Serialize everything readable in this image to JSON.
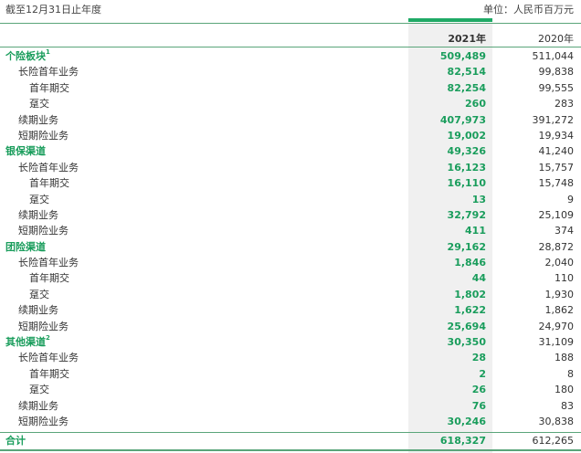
{
  "caption": {
    "period": "截至12月31日止年度",
    "unit": "单位：人民币百万元"
  },
  "header": {
    "col_2021": "2021年",
    "col_2020": "2020年"
  },
  "rows": [
    {
      "label": "个险板块",
      "sup": "1",
      "level": 0,
      "v2021": "509,489",
      "v2020": "511,044"
    },
    {
      "label": "长险首年业务",
      "level": 1,
      "v2021": "82,514",
      "v2020": "99,838"
    },
    {
      "label": "首年期交",
      "level": 2,
      "v2021": "82,254",
      "v2020": "99,555"
    },
    {
      "label": "趸交",
      "level": 2,
      "v2021": "260",
      "v2020": "283"
    },
    {
      "label": "续期业务",
      "level": 1,
      "v2021": "407,973",
      "v2020": "391,272"
    },
    {
      "label": "短期险业务",
      "level": 1,
      "v2021": "19,002",
      "v2020": "19,934"
    },
    {
      "label": "银保渠道",
      "level": 0,
      "v2021": "49,326",
      "v2020": "41,240"
    },
    {
      "label": "长险首年业务",
      "level": 1,
      "v2021": "16,123",
      "v2020": "15,757"
    },
    {
      "label": "首年期交",
      "level": 2,
      "v2021": "16,110",
      "v2020": "15,748"
    },
    {
      "label": "趸交",
      "level": 2,
      "v2021": "13",
      "v2020": "9"
    },
    {
      "label": "续期业务",
      "level": 1,
      "v2021": "32,792",
      "v2020": "25,109"
    },
    {
      "label": "短期险业务",
      "level": 1,
      "v2021": "411",
      "v2020": "374"
    },
    {
      "label": "团险渠道",
      "level": 0,
      "v2021": "29,162",
      "v2020": "28,872"
    },
    {
      "label": "长险首年业务",
      "level": 1,
      "v2021": "1,846",
      "v2020": "2,040"
    },
    {
      "label": "首年期交",
      "level": 2,
      "v2021": "44",
      "v2020": "110"
    },
    {
      "label": "趸交",
      "level": 2,
      "v2021": "1,802",
      "v2020": "1,930"
    },
    {
      "label": "续期业务",
      "level": 1,
      "v2021": "1,622",
      "v2020": "1,862"
    },
    {
      "label": "短期险业务",
      "level": 1,
      "v2021": "25,694",
      "v2020": "24,970"
    },
    {
      "label": "其他渠道",
      "sup": "2",
      "level": 0,
      "v2021": "30,350",
      "v2020": "31,109"
    },
    {
      "label": "长险首年业务",
      "level": 1,
      "v2021": "28",
      "v2020": "188"
    },
    {
      "label": "首年期交",
      "level": 2,
      "v2021": "2",
      "v2020": "8"
    },
    {
      "label": "趸交",
      "level": 2,
      "v2021": "26",
      "v2020": "180"
    },
    {
      "label": "续期业务",
      "level": 1,
      "v2021": "76",
      "v2020": "83"
    },
    {
      "label": "短期险业务",
      "level": 1,
      "v2021": "30,246",
      "v2020": "30,838"
    }
  ],
  "total": {
    "label": "合计",
    "v2021": "618,327",
    "v2020": "612,265"
  },
  "colors": {
    "accent": "#1a9d5c",
    "rule": "#5aa57a",
    "highlight_col": "#f0f0f0"
  }
}
